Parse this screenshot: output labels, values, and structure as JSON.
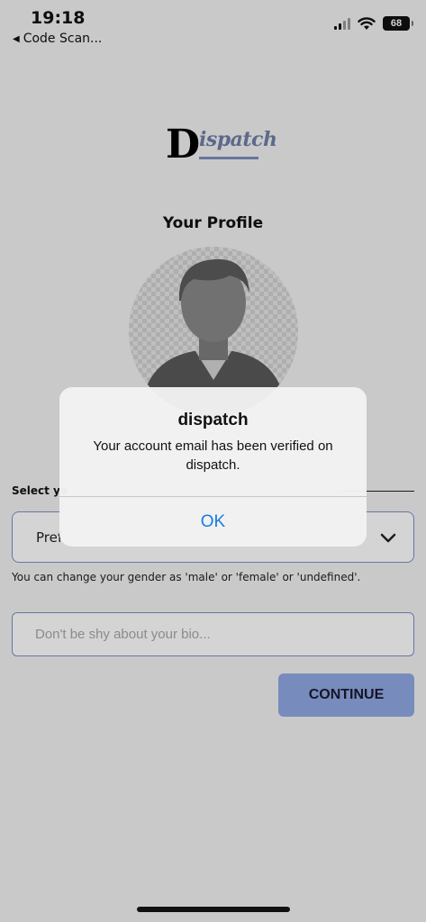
{
  "status_bar": {
    "time": "19:18",
    "back_app": "Code Scan...",
    "battery": "68"
  },
  "logo": {
    "first_letter": "D",
    "rest": "ispatch"
  },
  "profile": {
    "title": "Your Profile"
  },
  "gender": {
    "label": "Select yo",
    "selected_value": "Pref",
    "help_text": "You can change your gender as 'male' or 'female' or 'undefined'."
  },
  "bio": {
    "value": "",
    "placeholder": "Don't be shy about your bio..."
  },
  "continue_label": "CONTINUE",
  "alert": {
    "title": "dispatch",
    "message": "Your account email has been verified on dispatch.",
    "ok_label": "OK"
  },
  "colors": {
    "accent": "#90a8e3",
    "field_border": "#7c90c8",
    "alert_button": "#1a7be0"
  }
}
